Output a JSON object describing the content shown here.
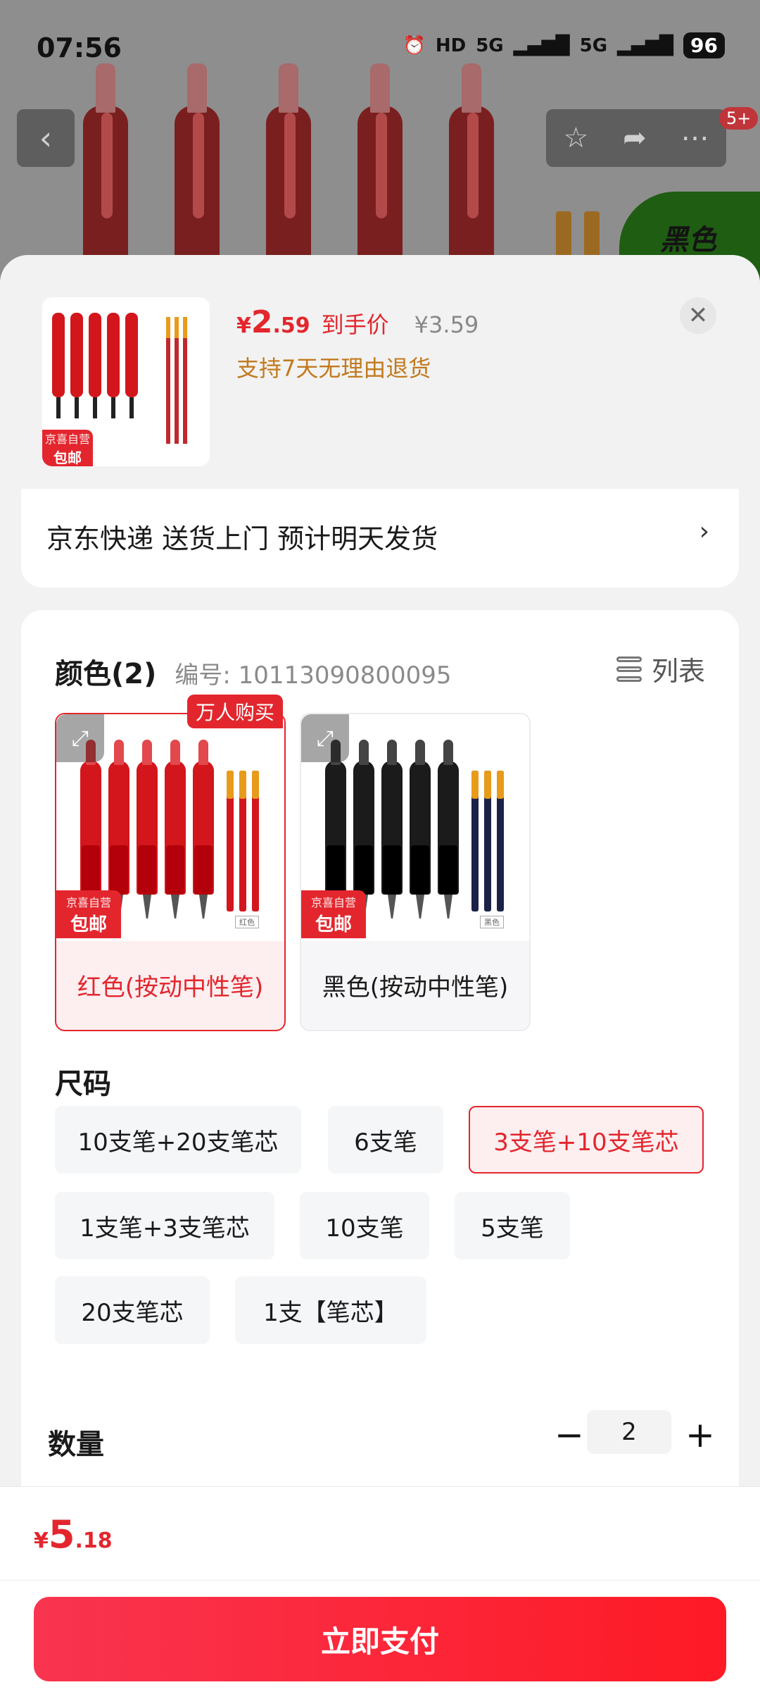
{
  "status_bar": {
    "time": "07:56",
    "icons": [
      "alarm-icon",
      "hd-icon",
      "signal-5g-icon",
      "signal-5g-icon"
    ],
    "hd": "HD",
    "net1": "5G",
    "net2": "5G",
    "battery": "96"
  },
  "top_nav": {
    "back_icon": "chevron-left-icon",
    "favorite_icon": "star-icon",
    "share_icon": "share-icon",
    "more_icon": "more-icon",
    "notification_count": "5+",
    "color_badge": "黑色"
  },
  "sheet": {
    "price": {
      "currency": "¥",
      "integer": "2",
      "decimal": ".59",
      "tag": "到手价",
      "original": "¥3.59"
    },
    "return_policy": "支持7天无理由退货",
    "close_icon": "close-icon",
    "thumbnail_badge": {
      "line1": "京喜自营",
      "line2": "包邮"
    },
    "shipping": {
      "text": "京东快递 送货上门 预计明天发货",
      "arrow": "›"
    },
    "color_section": {
      "title": "颜色(2)",
      "code": "编号: 10113090800095",
      "list_toggle": "列表",
      "options": [
        {
          "label": "红色(按动中性笔)",
          "selected": true,
          "badge": "万人购买",
          "jd_line1": "京喜自营",
          "jd_line2": "包邮",
          "refill_tag": "红色",
          "color": "#d3161c"
        },
        {
          "label": "黑色(按动中性笔)",
          "selected": false,
          "jd_line1": "京喜自营",
          "jd_line2": "包邮",
          "refill_tag": "黑色",
          "color": "#1b1b1b"
        }
      ]
    },
    "size_section": {
      "title": "尺码",
      "options": [
        {
          "label": "10支笔+20支笔芯",
          "selected": false
        },
        {
          "label": "6支笔",
          "selected": false
        },
        {
          "label": "3支笔+10支笔芯",
          "selected": true
        },
        {
          "label": "1支笔+3支笔芯",
          "selected": false
        },
        {
          "label": "10支笔",
          "selected": false
        },
        {
          "label": "5支笔",
          "selected": false
        },
        {
          "label": "20支笔芯",
          "selected": false
        },
        {
          "label": "1支【笔芯】",
          "selected": false
        }
      ]
    },
    "quantity": {
      "label": "数量",
      "value": "2",
      "minus": "−",
      "plus": "+"
    },
    "footer": {
      "total": {
        "currency": "¥",
        "integer": "5",
        "decimal": ".18"
      },
      "pay_button": "立即支付"
    }
  },
  "colors": {
    "accent": "#e3262d",
    "notice": "#c27a1e"
  }
}
